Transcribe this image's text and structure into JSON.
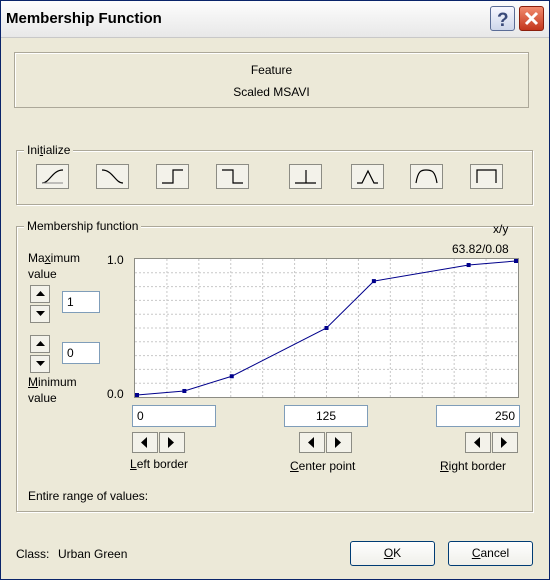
{
  "window": {
    "title": "Membership Function"
  },
  "feature": {
    "label": "Feature",
    "name": "Scaled MSAVI"
  },
  "initialize": {
    "label": "Initialize",
    "shapes": [
      "s-curve-rising",
      "s-curve-falling",
      "step-up",
      "step-down",
      "singleton",
      "triangle",
      "trapezoid",
      "rectangle"
    ]
  },
  "membership": {
    "label": "Membership function",
    "xy_label": "x/y",
    "readout": "63.82/0.08",
    "max_label": "Maximum value",
    "max_label_line1": "Maximum",
    "max_label_line2": "value",
    "max_value": "1",
    "min_label_line1": "Minimum",
    "min_label_line2": "value",
    "min_value": "0",
    "y_top": "1.0",
    "y_bottom": "0.0",
    "left_border": "0",
    "center_point": "125",
    "right_border": "250",
    "left_border_label": "Left border",
    "center_point_label": "Center point",
    "right_border_label": "Right border",
    "range_label": "Entire range of values:"
  },
  "chart_data": {
    "type": "line",
    "x": [
      0,
      31.25,
      62.5,
      93.75,
      125,
      156.25,
      187.5,
      218.75,
      250
    ],
    "values": [
      0,
      0.03,
      0.14,
      null,
      0.5,
      0.85,
      null,
      0.97,
      1.0
    ],
    "points": [
      [
        0,
        0
      ],
      [
        31.25,
        0.03
      ],
      [
        62.5,
        0.14
      ],
      [
        125,
        0.5
      ],
      [
        156.25,
        0.85
      ],
      [
        218.75,
        0.97
      ],
      [
        250,
        1.0
      ]
    ],
    "xlim": [
      0,
      250
    ],
    "ylim": [
      0,
      1
    ],
    "grid": true,
    "color": "#00008b"
  },
  "footer": {
    "class_label": "Class:",
    "class_value": "Urban Green",
    "ok": "OK",
    "cancel": "Cancel"
  }
}
